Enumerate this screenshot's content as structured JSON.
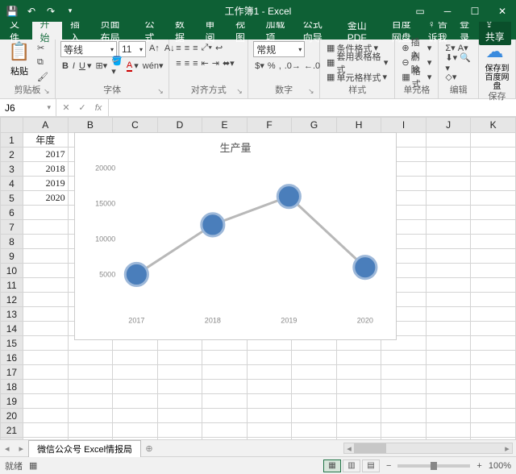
{
  "title": "工作簿1 - Excel",
  "tabs": [
    "文件",
    "开始",
    "插入",
    "页面布局",
    "公式",
    "数据",
    "审阅",
    "视图",
    "加载项",
    "公式向导",
    "金山PDF",
    "百度网盘"
  ],
  "active_tab": "开始",
  "tell_me": "♀ 告诉我",
  "signin": "登录",
  "share": "⇪ 共享",
  "ribbon": {
    "paste": "粘贴",
    "clipboard": "剪贴板",
    "font_name": "等线",
    "font_size": "11",
    "font": "字体",
    "align": "对齐方式",
    "num_fmt": "常规",
    "number": "数字",
    "cond_fmt": "条件格式",
    "tbl_fmt": "套用表格格式",
    "cell_style": "单元格样式",
    "styles": "样式",
    "insert": "插入",
    "delete": "删除",
    "format": "格式",
    "cells": "单元格",
    "edit": "编辑",
    "baidu": "保存到百度网盘",
    "baidu_group": "保存"
  },
  "namebox": "J6",
  "cols": [
    "A",
    "B",
    "C",
    "D",
    "E",
    "F",
    "G",
    "H",
    "I",
    "J",
    "K"
  ],
  "rows": 22,
  "cell_data": {
    "A1": "年度",
    "A2": "2017",
    "A3": "2018",
    "A4": "2019",
    "A5": "2020"
  },
  "sheet_tab": "微信公众号 Excel情报局",
  "status": "就绪",
  "rec": "▦",
  "zoom_label": "100%",
  "chart_data": {
    "type": "line",
    "title": "生产量",
    "categories": [
      "2017",
      "2018",
      "2019",
      "2020"
    ],
    "values": [
      5000,
      12000,
      16000,
      6000
    ],
    "ylim": [
      0,
      20000
    ],
    "yticks": [
      5000,
      10000,
      15000,
      20000
    ],
    "xlabel": "",
    "ylabel": ""
  }
}
